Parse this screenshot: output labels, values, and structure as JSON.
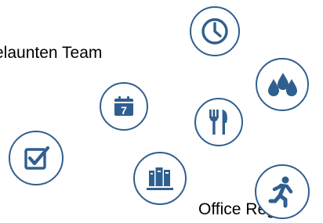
{
  "texts": {
    "line1": "elaunten Team",
    "line2": "Office Regeln"
  },
  "icons": [
    "clock-icon",
    "water-drops-icon",
    "calendar-icon",
    "fork-knife-icon",
    "checkbox-icon",
    "books-icon",
    "running-person-icon"
  ],
  "colors": {
    "icon_stroke": "#2F5F8F",
    "icon_fill": "#2F5F8F",
    "text": "#000000",
    "background": "#FFFFFF"
  },
  "calendar_day": "7"
}
